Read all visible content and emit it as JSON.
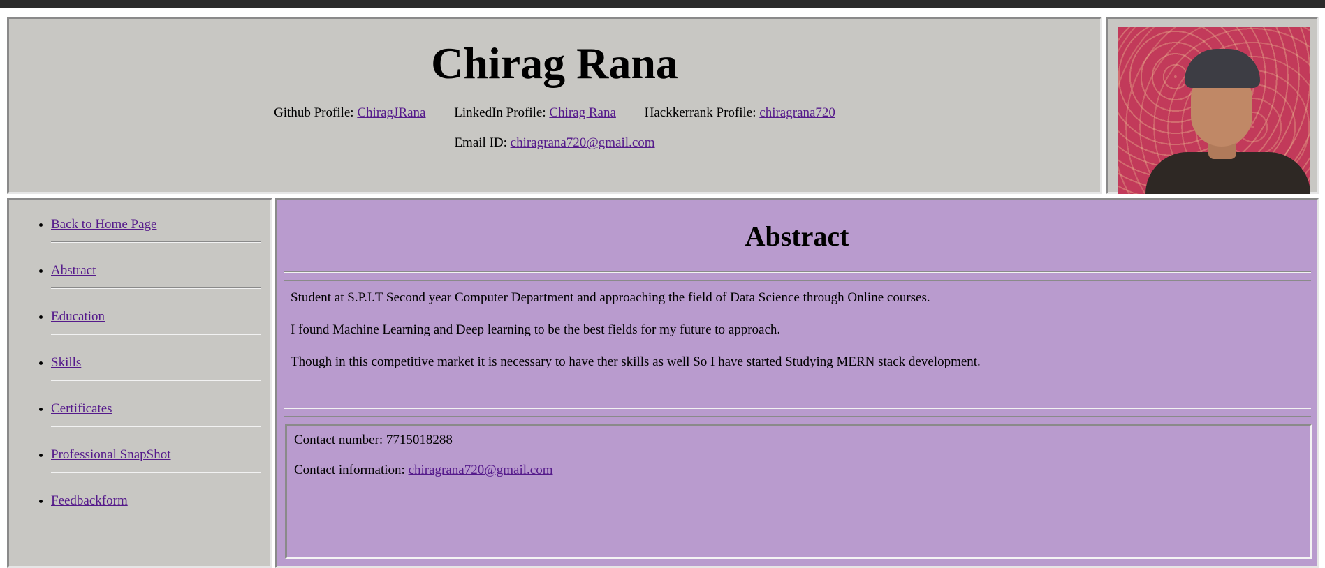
{
  "header": {
    "name": "Chirag Rana",
    "github_label": "Github Profile: ",
    "github_link": "ChiragJRana",
    "linkedin_label": "LinkedIn Profile: ",
    "linkedin_link": "Chirag Rana",
    "hackerrank_label": "Hackkerrank Profile: ",
    "hackerrank_link": "chiragrana720",
    "email_label": "Email ID: ",
    "email_link": "chiragrana720@gmail.com"
  },
  "sidebar": {
    "items": [
      {
        "label": "Back to Home Page"
      },
      {
        "label": "Abstract"
      },
      {
        "label": "Education"
      },
      {
        "label": "Skills"
      },
      {
        "label": "Certificates"
      },
      {
        "label": "Professional SnapShot"
      },
      {
        "label": "Feedbackform"
      }
    ]
  },
  "main": {
    "title": "Abstract",
    "paragraphs": [
      "Student at S.P.I.T Second year Computer Department and approaching the field of Data Science through Online courses.",
      "I found Machine Learning and Deep learning to be the best fields for my future to approach.",
      "Though in this competitive market it is necessary to have ther skills as well So I have started Studying MERN stack development."
    ],
    "contact": {
      "number_text": "Contact number: 7715018288",
      "info_label": "Contact information: ",
      "info_link": "chiragrana720@gmail.com"
    }
  },
  "colors": {
    "header_bg": "#c8c7c3",
    "main_bg": "#b99bce",
    "link": "#551a8b"
  }
}
